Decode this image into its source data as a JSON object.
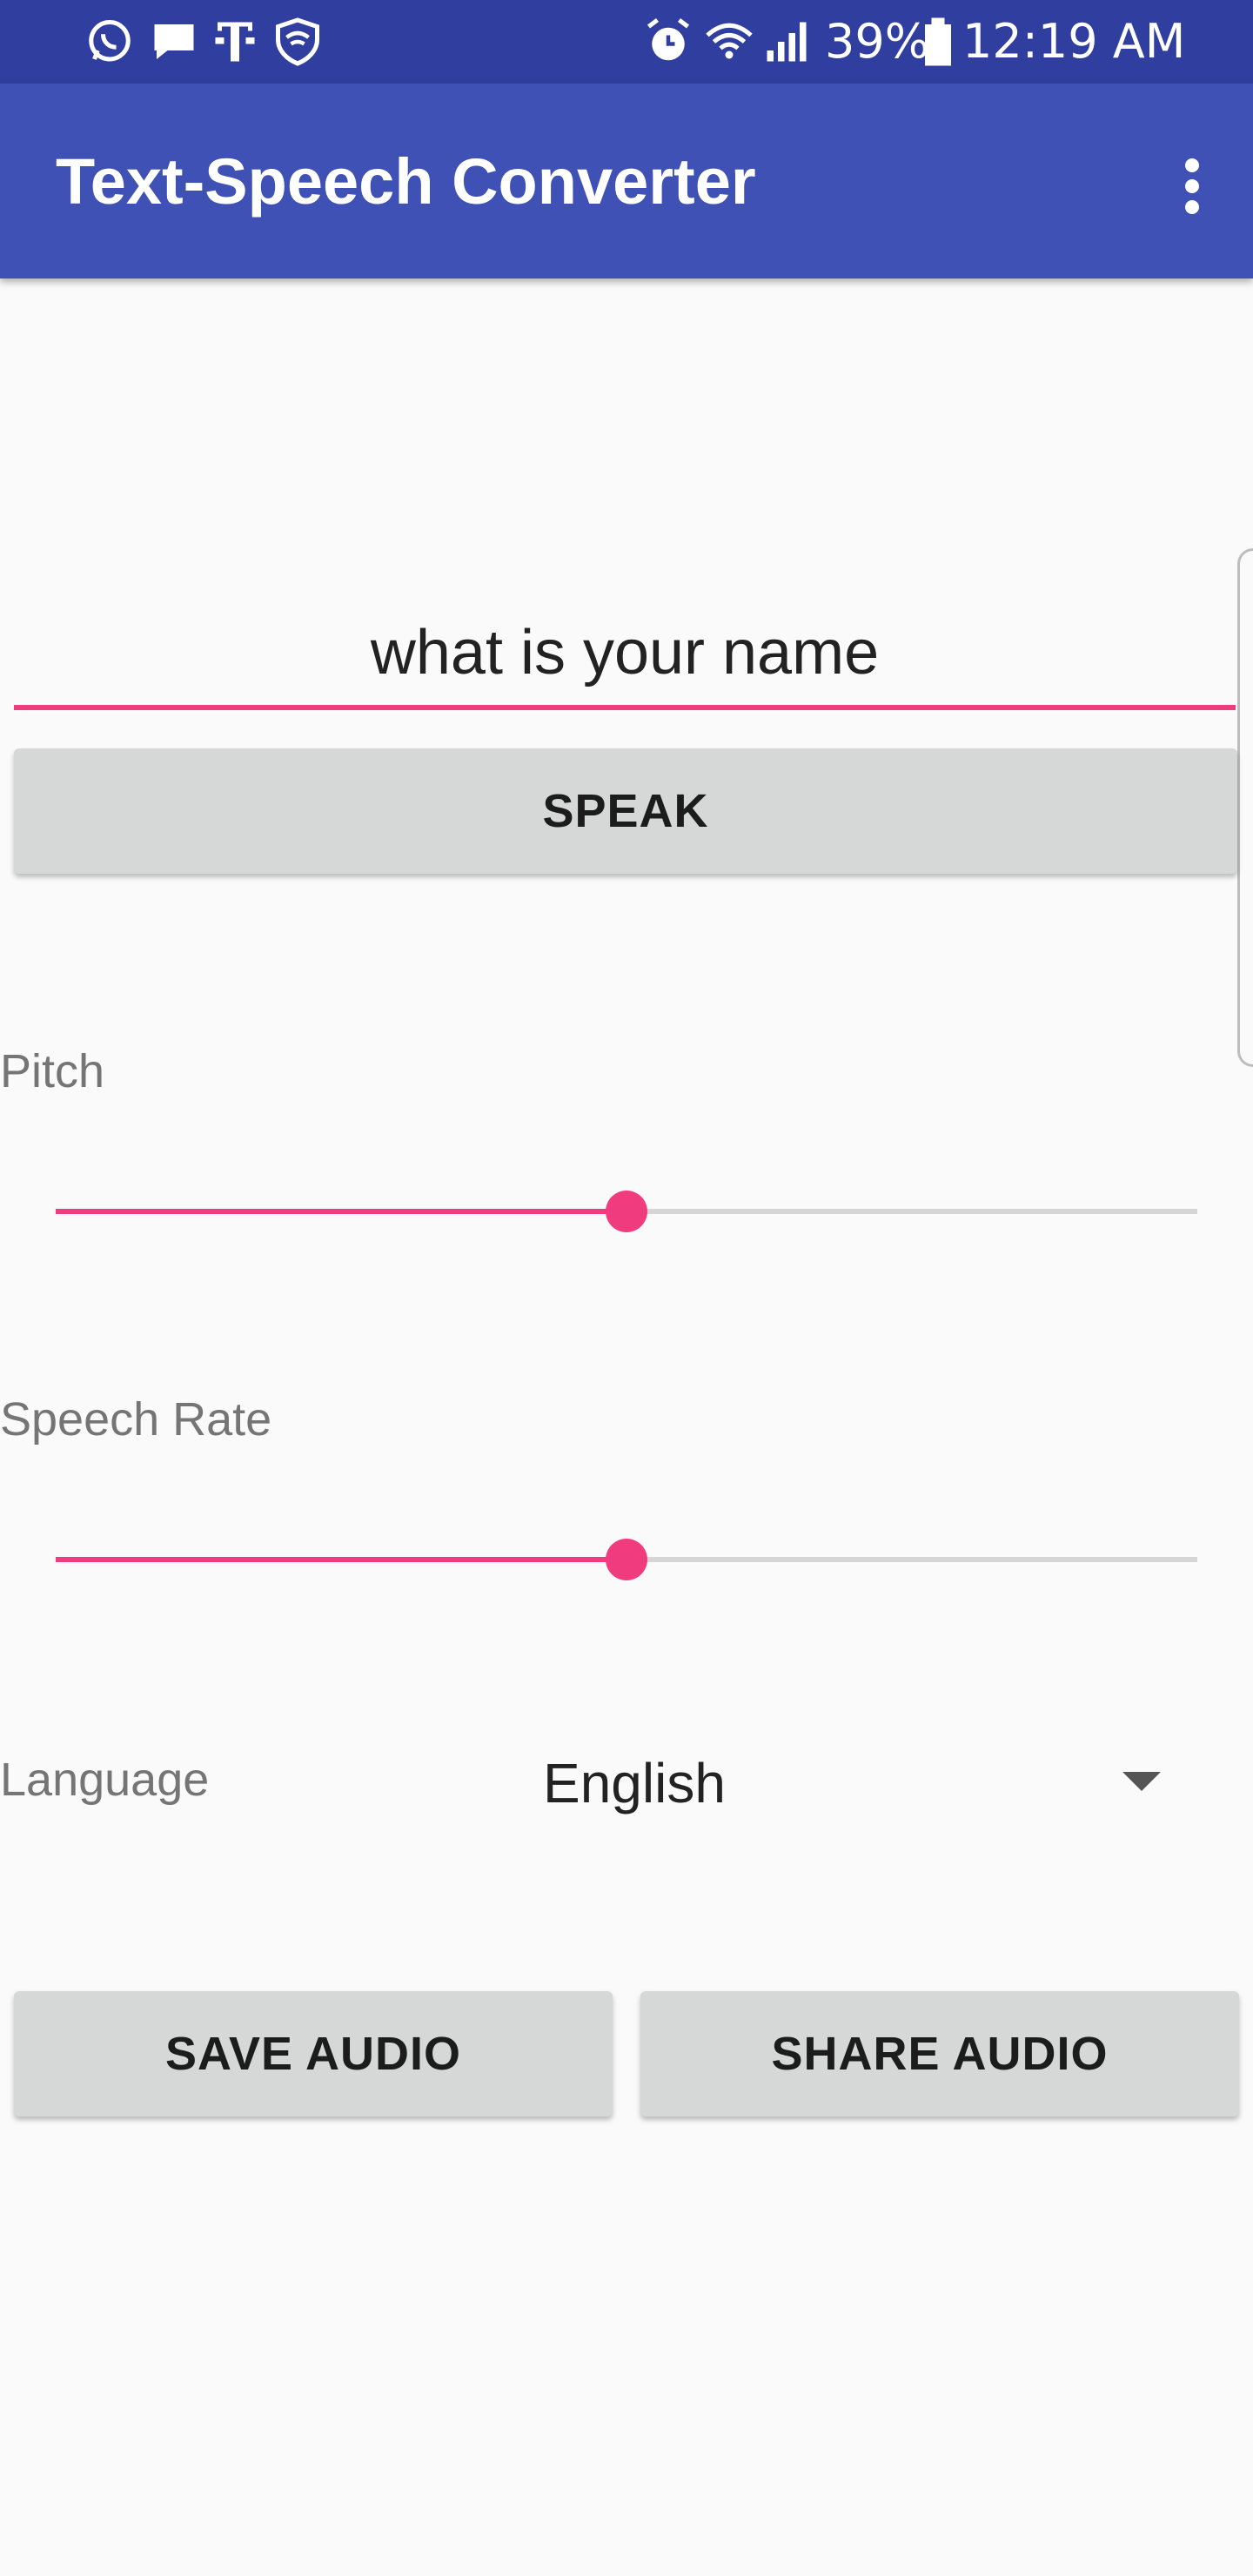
{
  "status_bar": {
    "battery": "39%",
    "time": "12:19 AM",
    "left_icons": [
      "whatsapp-icon",
      "message-icon",
      "t-mobile-icon",
      "shield-icon"
    ],
    "right_icons": [
      "alarm-icon",
      "wifi-icon",
      "signal-icon",
      "battery-icon"
    ]
  },
  "app_bar": {
    "title": "Text-Speech Converter",
    "menu_icon": "overflow-menu-icon"
  },
  "input": {
    "value": "what is your name"
  },
  "speak_button": {
    "label": "SPEAK"
  },
  "pitch": {
    "label": "Pitch",
    "value_fraction": 0.5
  },
  "speech_rate": {
    "label": "Speech Rate",
    "value_fraction": 0.5
  },
  "language": {
    "label": "Language",
    "selected": "English"
  },
  "save_button": {
    "label": "SAVE AUDIO"
  },
  "share_button": {
    "label": "SHARE AUDIO"
  },
  "colors": {
    "status_bar": "#303f9f",
    "app_bar": "#3f51b5",
    "accent": "#f03c7e",
    "button": "#d6d7d7",
    "background": "#fafafa"
  }
}
